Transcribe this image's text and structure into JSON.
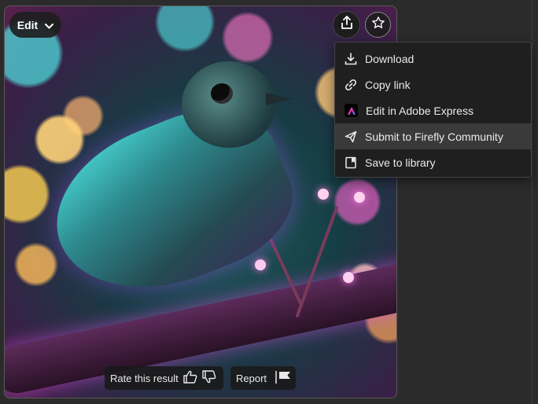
{
  "image": {
    "alt_icon": "generated-image"
  },
  "edit_button": {
    "label": "Edit",
    "icon": "chevron-down-icon"
  },
  "share_button": {
    "icon": "share-icon"
  },
  "favorite_button": {
    "icon": "star-icon"
  },
  "share_menu": {
    "items": [
      {
        "label": "Download",
        "icon": "download-icon"
      },
      {
        "label": "Copy link",
        "icon": "link-icon"
      },
      {
        "label": "Edit in Adobe Express",
        "icon": "adobe-express-icon"
      },
      {
        "label": "Submit to Firefly Community",
        "icon": "send-icon",
        "highlighted": true
      },
      {
        "label": "Save to library",
        "icon": "library-icon"
      }
    ]
  },
  "feedback": {
    "rate_label": "Rate this result",
    "thumbs_up_icon": "thumbs-up-icon",
    "thumbs_down_icon": "thumbs-down-icon",
    "report_label": "Report",
    "report_icon": "flag-icon"
  },
  "colors": {
    "menu_bg": "#1f1f1f",
    "menu_hover": "#3a3a3a",
    "page_bg": "#2b2b2b"
  }
}
